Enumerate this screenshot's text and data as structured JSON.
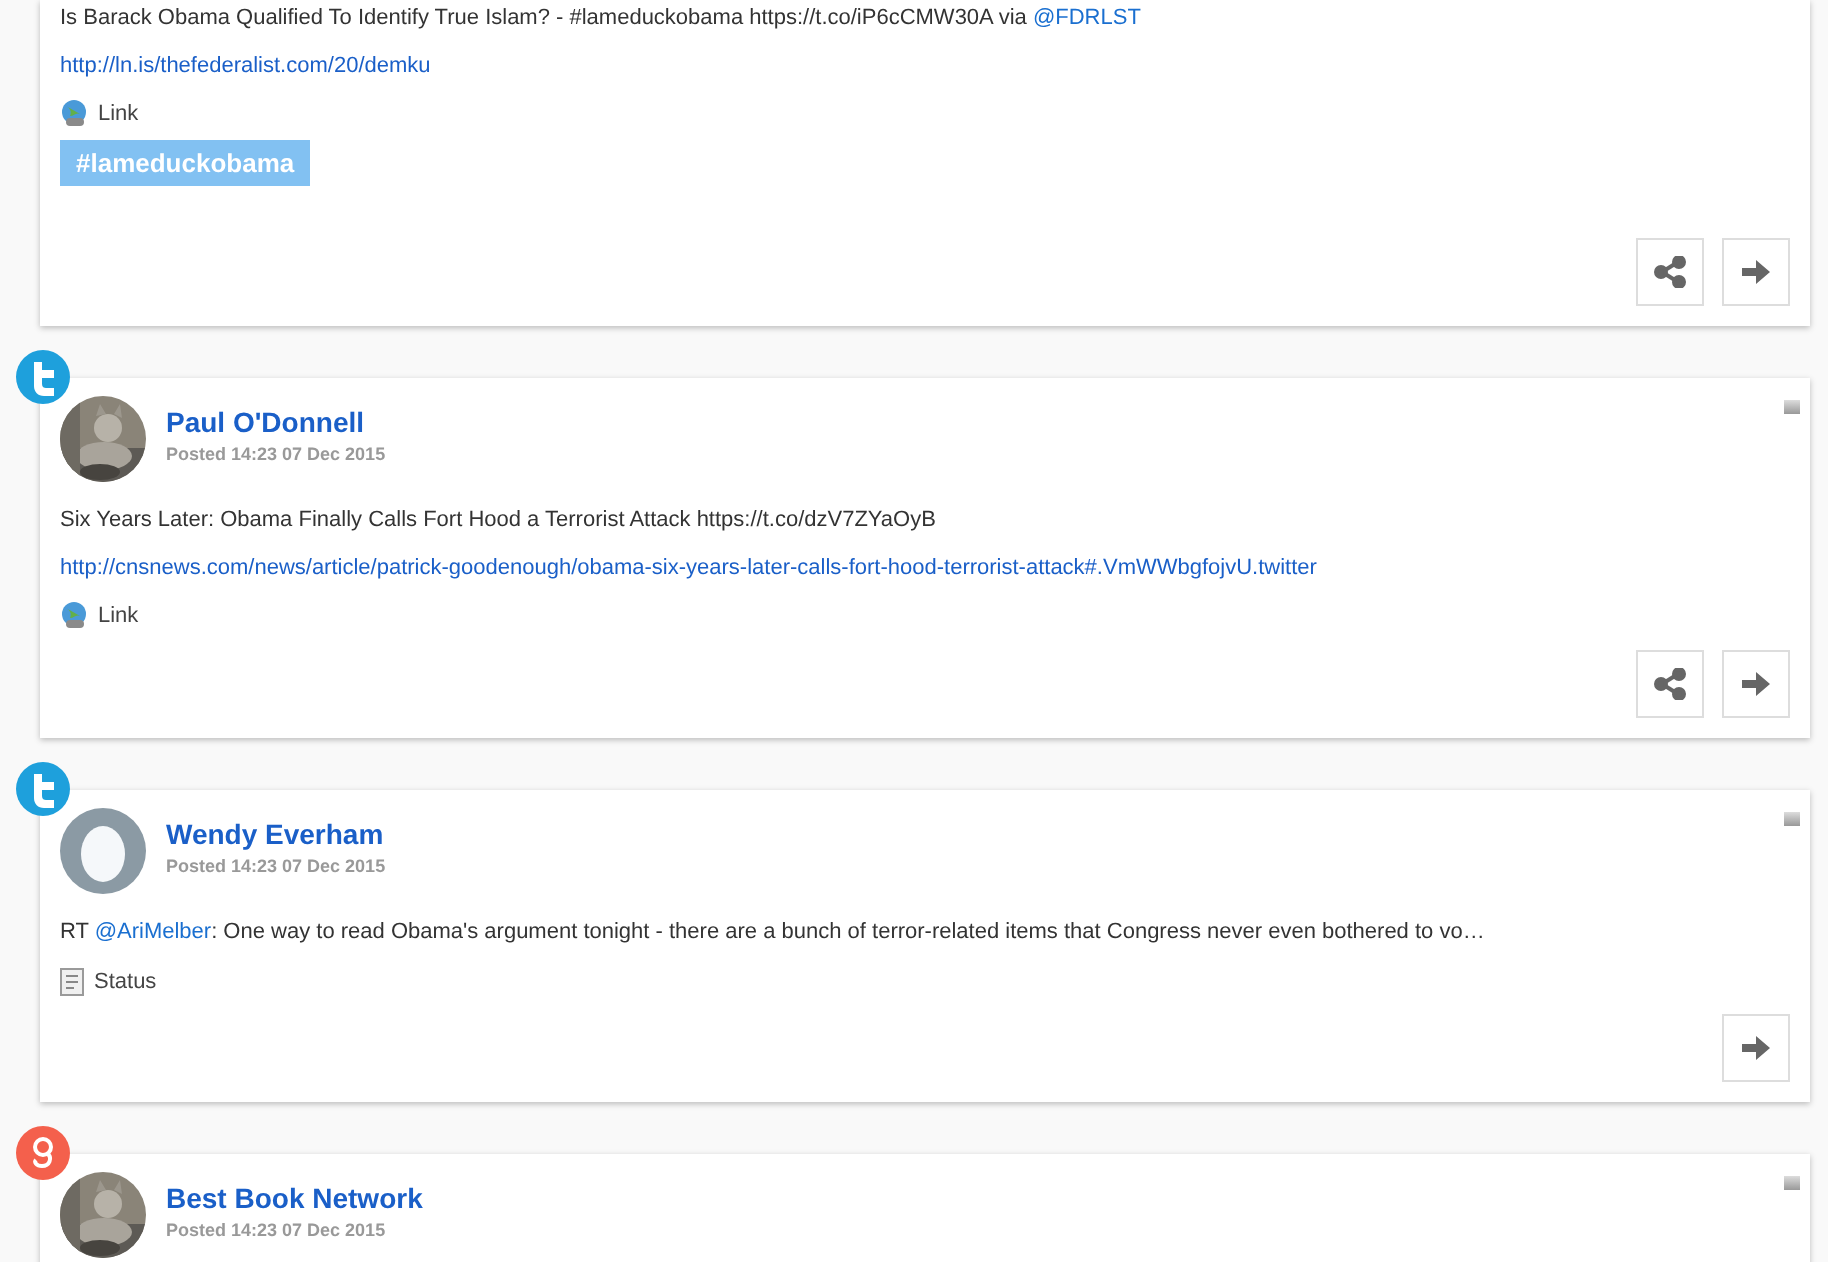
{
  "posts": [
    {
      "menu": false,
      "text": [
        {
          "kind": "plain",
          "text": "Is Barack Obama Qualified To Identify True Islam? - #lameduckobama https://t.co/iP6cCMW30A via "
        },
        {
          "kind": "mention",
          "text": "@FDRLST"
        }
      ],
      "url": "http://ln.is/thefederalist.com/20/demku",
      "type": {
        "kind": "link",
        "label": "Link"
      },
      "hashtag": "#lameduckobama",
      "actions": [
        {
          "kind": "share"
        },
        {
          "kind": "forward"
        }
      ]
    },
    {
      "badge": {
        "kind": "twitter"
      },
      "author": "Paul O'Donnell",
      "posted": "Posted 14:23 07 Dec 2015",
      "avatar": {
        "kind": "picture"
      },
      "menu": true,
      "text": [
        {
          "kind": "plain",
          "text": "Six Years Later: Obama Finally Calls Fort Hood a Terrorist Attack https://t.co/dzV7ZYaOyB"
        }
      ],
      "url": "http://cnsnews.com/news/article/patrick-goodenough/obama-six-years-later-calls-fort-hood-terrorist-attack#.VmWWbgfojvU.twitter",
      "type": {
        "kind": "link",
        "label": "Link"
      },
      "actions": [
        {
          "kind": "share"
        },
        {
          "kind": "forward"
        }
      ]
    },
    {
      "badge": {
        "kind": "twitter"
      },
      "author": "Wendy Everham",
      "posted": "Posted 14:23 07 Dec 2015",
      "avatar": {
        "kind": "egg"
      },
      "menu": true,
      "text": [
        {
          "kind": "plain",
          "text": "RT "
        },
        {
          "kind": "mention",
          "text": "@AriMelber"
        },
        {
          "kind": "plain",
          "text": ": One way to read Obama's argument tonight - there are a bunch of terror-related items that Congress never even bothered to vo…"
        }
      ],
      "type": {
        "kind": "status",
        "label": "Status"
      },
      "actions": [
        {
          "kind": "forward"
        }
      ]
    },
    {
      "badge": {
        "kind": "google"
      },
      "author": "Best Book Network",
      "posted": "Posted 14:23 07 Dec 2015",
      "avatar": {
        "kind": "picture"
      },
      "menu": true
    }
  ]
}
